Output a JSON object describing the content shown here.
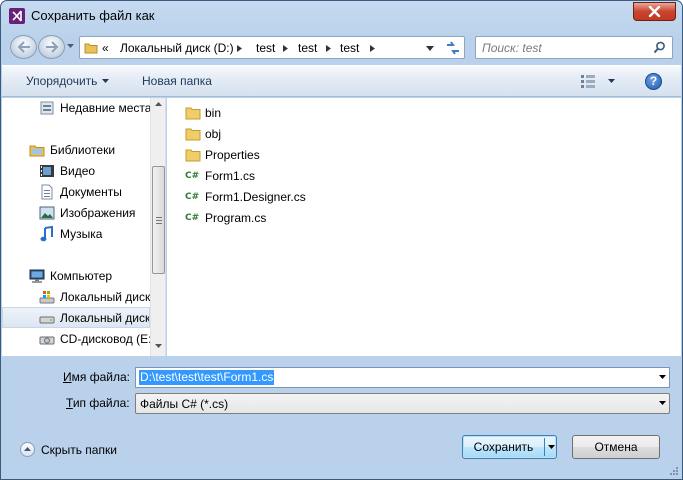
{
  "window": {
    "title": "Сохранить файл как"
  },
  "address": {
    "crumbs": [
      "Локальный диск (D:)",
      "test",
      "test",
      "test"
    ],
    "overflow": "«"
  },
  "search": {
    "placeholder": "Поиск: test"
  },
  "toolbar": {
    "organize_label": "Упорядочить",
    "new_folder_label": "Новая папка",
    "help_label": "?"
  },
  "nav_pane": {
    "items": [
      {
        "label": "Недавние места",
        "icon": "recent-places-icon"
      },
      {
        "label": "Библиотеки",
        "icon": "libraries-icon"
      },
      {
        "label": "Видео",
        "icon": "video-icon"
      },
      {
        "label": "Документы",
        "icon": "documents-icon"
      },
      {
        "label": "Изображения",
        "icon": "pictures-icon"
      },
      {
        "label": "Музыка",
        "icon": "music-icon"
      },
      {
        "label": "Компьютер",
        "icon": "computer-icon"
      },
      {
        "label": "Локальный диск",
        "icon": "system-drive-icon"
      },
      {
        "label": "Локальный диск",
        "icon": "drive-icon",
        "selected": true
      },
      {
        "label": "CD-дисковод (E:",
        "icon": "cd-drive-icon"
      }
    ]
  },
  "files": [
    {
      "name": "bin",
      "type": "folder"
    },
    {
      "name": "obj",
      "type": "folder"
    },
    {
      "name": "Properties",
      "type": "folder"
    },
    {
      "name": "Form1.cs",
      "type": "cs"
    },
    {
      "name": "Form1.Designer.cs",
      "type": "cs"
    },
    {
      "name": "Program.cs",
      "type": "cs"
    }
  ],
  "form": {
    "filename_label_u": "И",
    "filename_label_rest": "мя файла:",
    "filename_value": "D:\\test\\test\\test\\Form1.cs",
    "filetype_label_u": "Т",
    "filetype_label_rest": "ип файла:",
    "filetype_value": "Файлы C# (*.cs)"
  },
  "footer": {
    "hide_folders_label": "Скрыть папки",
    "save_label": "Сохранить",
    "cancel_label": "Отмена"
  },
  "colors": {
    "accent": "#3399ff",
    "link_blue": "#1e395b",
    "cs_green": "#2f7d32",
    "vs_purple": "#68217a"
  }
}
